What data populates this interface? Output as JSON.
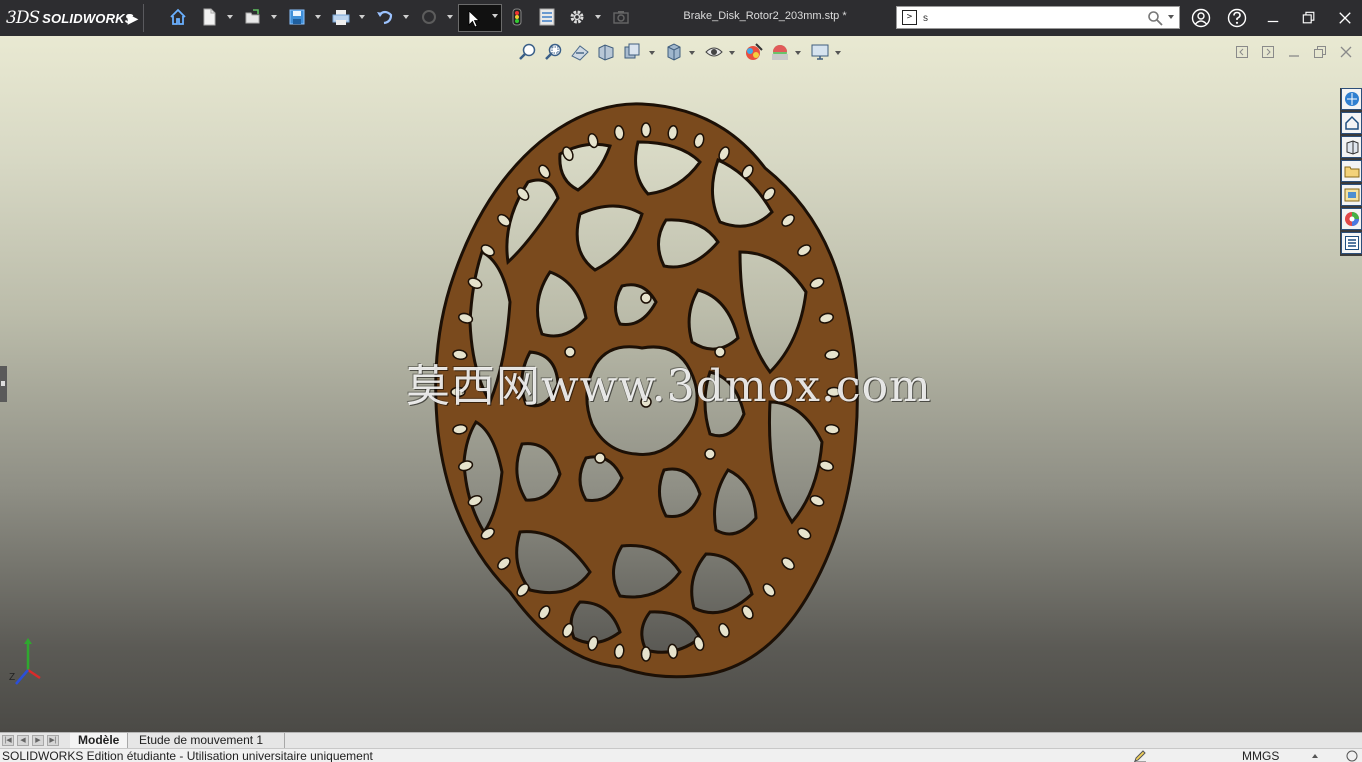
{
  "app": {
    "logo_mark": "3DS",
    "logo_text": "SOLIDWORKS",
    "document_title": "Brake_Disk_Rotor2_203mm.stp *"
  },
  "toolbar": {
    "items": [
      "home-icon",
      "new-document-icon",
      "open-icon",
      "save-icon",
      "print-icon",
      "undo-icon",
      "redo-icon",
      "select-arrow-icon",
      "rebuild-traffic-light-icon",
      "file-properties-icon",
      "options-gear-icon",
      "screen-capture-icon"
    ]
  },
  "search": {
    "value": "s",
    "placeholder": ""
  },
  "window_controls": [
    "user-icon",
    "help-icon",
    "minimize-icon",
    "restore-icon",
    "close-icon"
  ],
  "heads_up_toolbar": {
    "items": [
      "zoom-to-fit-icon",
      "zoom-to-area-icon",
      "previous-view-icon",
      "section-view-icon",
      "view-orientation-icon",
      "display-style-icon",
      "hide-show-items-icon",
      "edit-appearance-icon",
      "apply-scene-icon",
      "view-settings-icon"
    ]
  },
  "task_pane": {
    "items": [
      "solidworks-resources-icon",
      "design-library-icon",
      "file-explorer-icon",
      "view-palette-icon",
      "appearances-scenes-icon",
      "custom-properties-icon"
    ]
  },
  "viewport": {
    "model_color": "#7a4a1d",
    "watermark": "莫西网www.3dmox.com"
  },
  "triad": {
    "z_label": "Z"
  },
  "tabs": {
    "model": "Modèle",
    "motion": "Etude de mouvement 1"
  },
  "status": {
    "text": "SOLIDWORKS Edition étudiante - Utilisation universitaire uniquement",
    "units": "MMGS"
  }
}
